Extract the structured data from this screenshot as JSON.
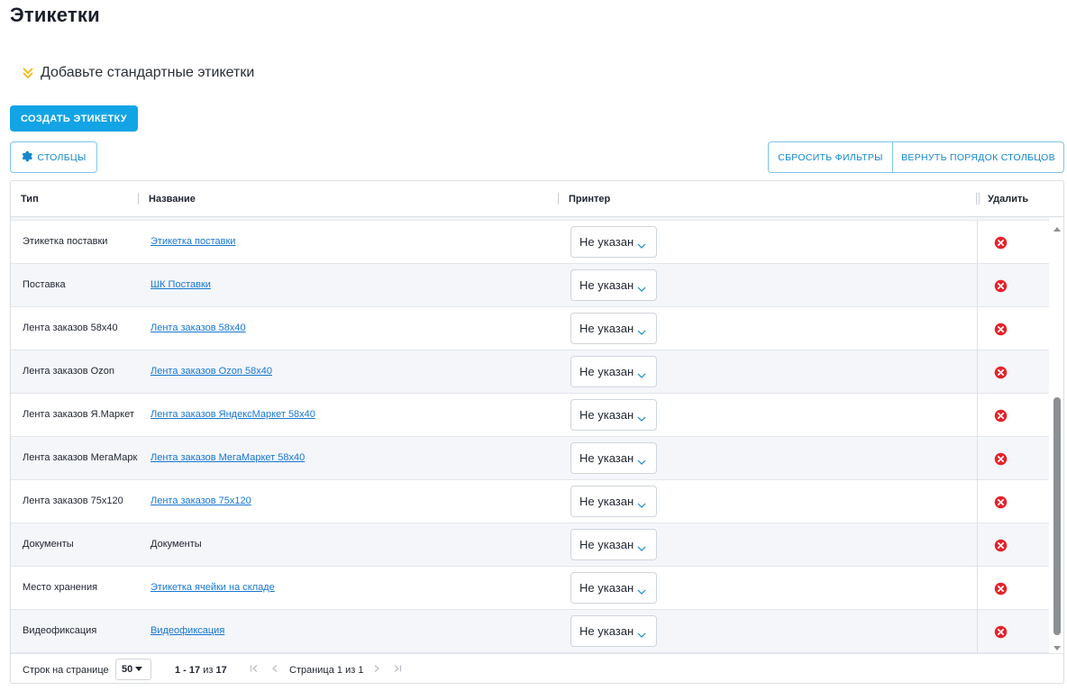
{
  "page": {
    "title": "Этикетки"
  },
  "standard_labels": {
    "label": "Добавьте стандартные этикетки"
  },
  "toolbar": {
    "create_label": "СОЗДАТЬ ЭТИКЕТКУ",
    "columns": "СТОЛБЦЫ",
    "reset_filters": "СБРОСИТЬ ФИЛЬТРЫ",
    "restore_column_order": "ВЕРНУТЬ ПОРЯДОК СТОЛБЦОВ"
  },
  "table": {
    "columns": {
      "type": "Тип",
      "name": "Название",
      "printer": "Принтер",
      "delete": "Удалить"
    },
    "rows": [
      {
        "type": "Этикетка поставки",
        "name": "Этикетка поставки",
        "link": true,
        "printer": "Не указан"
      },
      {
        "type": "Поставка",
        "name": "ШК Поставки",
        "link": true,
        "printer": "Не указан"
      },
      {
        "type": "Лента заказов 58x40",
        "name": "Лента заказов 58x40",
        "link": true,
        "printer": "Не указан"
      },
      {
        "type": "Лента заказов Ozon",
        "name": "Лента заказов Ozon 58x40",
        "link": true,
        "printer": "Не указан"
      },
      {
        "type": "Лента заказов Я.Маркет",
        "name": "Лента заказов ЯндексМаркет 58x40",
        "link": true,
        "printer": "Не указан"
      },
      {
        "type": "Лента заказов МегаМаркет",
        "name": "Лента заказов МегаМаркет 58x40",
        "link": true,
        "printer": "Не указан"
      },
      {
        "type": "Лента заказов 75x120",
        "name": "Лента заказов 75x120",
        "link": true,
        "printer": "Не указан"
      },
      {
        "type": "Документы",
        "name": "Документы",
        "link": false,
        "printer": "Не указан"
      },
      {
        "type": "Место хранения",
        "name": "Этикетка ячейки на складе",
        "link": true,
        "printer": "Не указан"
      },
      {
        "type": "Видеофиксация",
        "name": "Видеофиксация",
        "link": true,
        "printer": "Не указан"
      }
    ]
  },
  "pagination": {
    "rows_per_page_label": "Строк на странице",
    "rows_per_page": "50",
    "range": "1 - 17",
    "range_of": "из",
    "total": "17",
    "page_label": "Страница 1 из 1"
  },
  "colors": {
    "accent": "#13a4e6",
    "link": "#1677d2",
    "delete": "#e5222a",
    "chevron": "#f0b400"
  }
}
